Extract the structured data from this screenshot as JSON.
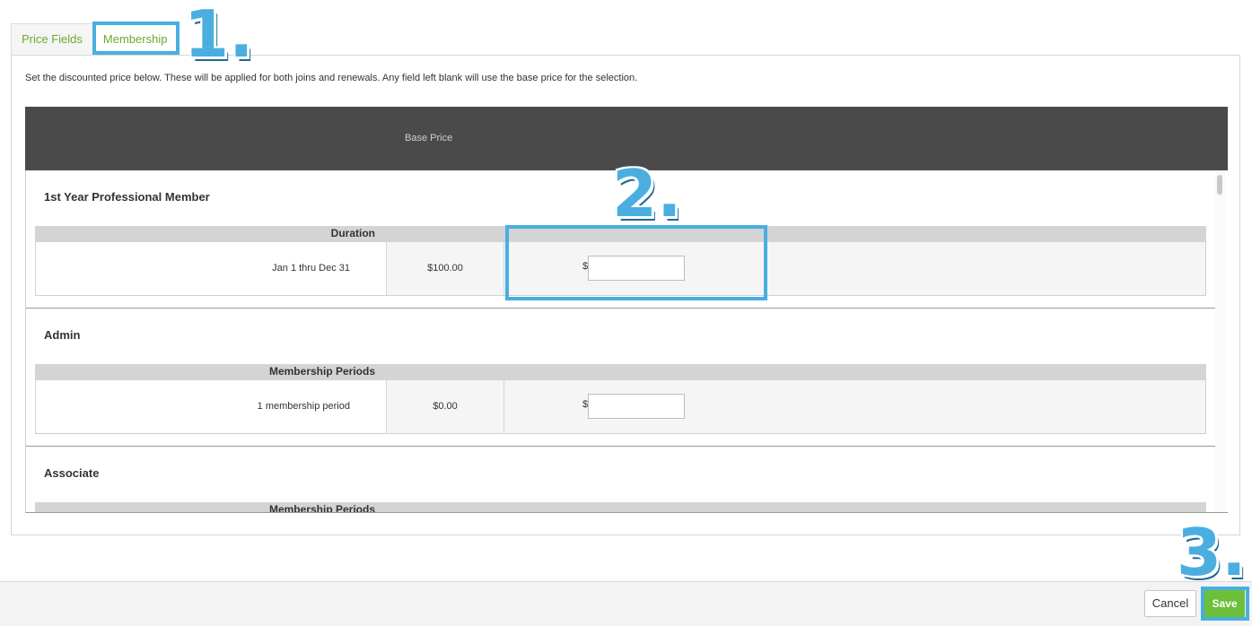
{
  "tabs": [
    {
      "label": "Price Fields",
      "active": false
    },
    {
      "label": "Membership",
      "active": true
    }
  ],
  "intro_text": "Set the discounted price below. These will be applied for both joins and renewals. Any field left blank will use the base price for the selection.",
  "grid": {
    "header_label": "Base Price",
    "groups": [
      {
        "title": "1st Year Professional Member",
        "sub_header": "Duration",
        "row": {
          "label": "Jan 1 thru Dec 31",
          "price": "$100.00",
          "currency": "$",
          "input_value": ""
        }
      },
      {
        "title": "Admin",
        "sub_header": "Membership Periods",
        "row": {
          "label": "1 membership period",
          "price": "$0.00",
          "currency": "$",
          "input_value": ""
        }
      },
      {
        "title": "Associate",
        "sub_header": "Membership Periods"
      }
    ]
  },
  "footer": {
    "cancel_label": "Cancel",
    "save_label": "Save"
  },
  "annotations": {
    "step1": "1.",
    "step2": "2.",
    "step3": "3."
  },
  "colors": {
    "accent_green": "#6aaa2f",
    "save_green": "#6cbf3a",
    "annotation_blue": "#4aaee0",
    "header_dark": "#4a4a4a"
  }
}
